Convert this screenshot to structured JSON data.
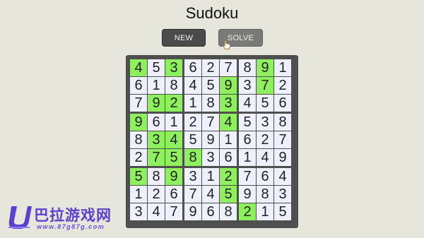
{
  "title": "Sudoku",
  "buttons": {
    "new_label": "NEW",
    "solve_label": "SOLVE"
  },
  "grid": [
    [
      4,
      5,
      3,
      6,
      2,
      7,
      8,
      9,
      1
    ],
    [
      6,
      1,
      8,
      4,
      5,
      9,
      3,
      7,
      2
    ],
    [
      7,
      9,
      2,
      1,
      8,
      3,
      4,
      5,
      6
    ],
    [
      9,
      6,
      1,
      2,
      7,
      4,
      5,
      3,
      8
    ],
    [
      8,
      3,
      4,
      5,
      9,
      1,
      6,
      2,
      7
    ],
    [
      2,
      7,
      5,
      8,
      3,
      6,
      1,
      4,
      9
    ],
    [
      5,
      8,
      9,
      3,
      1,
      2,
      7,
      6,
      4
    ],
    [
      1,
      2,
      6,
      7,
      4,
      5,
      9,
      8,
      3
    ],
    [
      3,
      4,
      7,
      9,
      6,
      8,
      2,
      1,
      5
    ]
  ],
  "highlighted_cells": [
    [
      0,
      0
    ],
    [
      0,
      2
    ],
    [
      0,
      7
    ],
    [
      1,
      5
    ],
    [
      1,
      7
    ],
    [
      2,
      1
    ],
    [
      2,
      2
    ],
    [
      2,
      5
    ],
    [
      3,
      0
    ],
    [
      3,
      5
    ],
    [
      4,
      1
    ],
    [
      4,
      2
    ],
    [
      5,
      1
    ],
    [
      5,
      2
    ],
    [
      5,
      3
    ],
    [
      6,
      0
    ],
    [
      6,
      2
    ],
    [
      6,
      5
    ],
    [
      7,
      5
    ],
    [
      8,
      6
    ]
  ],
  "colors": {
    "background": "#e7e6dc",
    "board_frame": "#4f4f4f",
    "cell": "#eef0fb",
    "highlight": "#8ff05e",
    "new_button": "#4b4b4b",
    "solve_button": "#7a7a79"
  },
  "cursor_icon": "hand-pointer-icon",
  "watermark": {
    "logo_icon": "u-logo-icon",
    "text": "巴拉游戏网",
    "url": "www.87g87g.com"
  }
}
